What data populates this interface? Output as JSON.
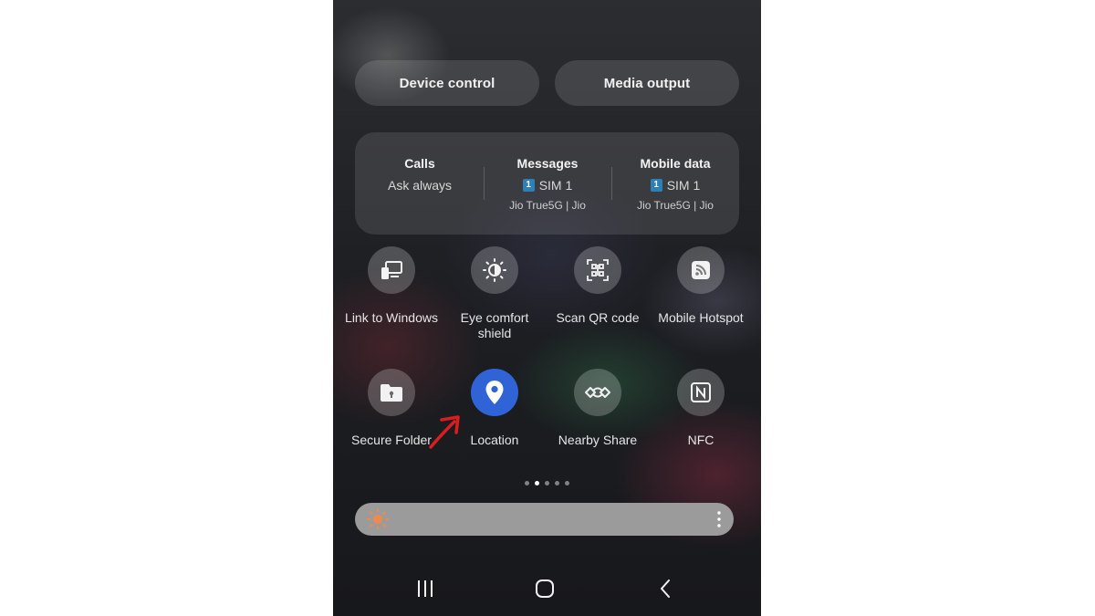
{
  "top_buttons": {
    "device_control": "Device control",
    "media_output": "Media output"
  },
  "sim_panel": {
    "calls": {
      "title": "Calls",
      "value": "Ask always"
    },
    "messages": {
      "title": "Messages",
      "sim_badge": "1",
      "sim": "SIM 1",
      "carrier": "Jio True5G | Jio"
    },
    "mobile_data": {
      "title": "Mobile data",
      "sim_badge": "1",
      "sim": "SIM 1",
      "carrier": "Jio True5G | Jio"
    }
  },
  "quick_tiles": {
    "row1": [
      {
        "label": "Link to Windows",
        "icon": "link-to-windows-icon",
        "active": false
      },
      {
        "label": "Eye comfort shield",
        "icon": "eye-comfort-icon",
        "active": false
      },
      {
        "label": "Scan QR code",
        "icon": "qr-code-icon",
        "active": false
      },
      {
        "label": "Mobile Hotspot",
        "icon": "hotspot-icon",
        "active": false
      }
    ],
    "row2": [
      {
        "label": "Secure Folder",
        "icon": "secure-folder-icon",
        "active": false
      },
      {
        "label": "Location",
        "icon": "location-pin-icon",
        "active": true
      },
      {
        "label": "Nearby Share",
        "icon": "nearby-share-icon",
        "active": false
      },
      {
        "label": "NFC",
        "icon": "nfc-icon",
        "active": false
      }
    ]
  },
  "page_indicator": {
    "count": 5,
    "active_index": 1
  },
  "brightness": {
    "icon": "sun-icon",
    "level": 1.0
  },
  "colors": {
    "active_tile": "#2f63d6",
    "sim_badge": "#2f7fb7",
    "annotation_arrow": "#d81e1e",
    "brightness_sun": "#f08a4b"
  }
}
